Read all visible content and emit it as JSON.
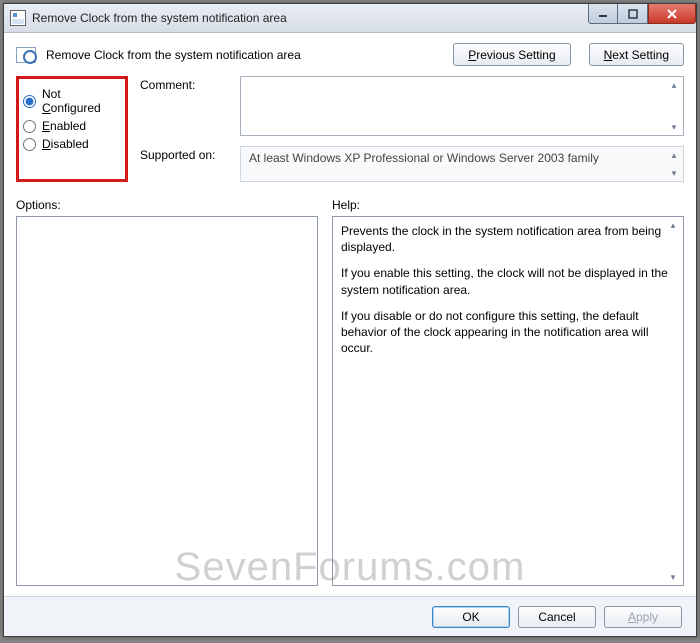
{
  "window": {
    "title": "Remove Clock from the system notification area"
  },
  "header": {
    "text": "Remove Clock from the system notification area",
    "prev_p": "P",
    "prev_rest": "revious Setting",
    "next_n": "N",
    "next_rest": "ext Setting"
  },
  "state": {
    "options": [
      {
        "key": "not_configured",
        "prefix": "Not ",
        "u": "C",
        "suffix": "onfigured",
        "checked": true
      },
      {
        "key": "enabled",
        "prefix": "",
        "u": "E",
        "suffix": "nabled",
        "checked": false
      },
      {
        "key": "disabled",
        "prefix": "",
        "u": "D",
        "suffix": "isabled",
        "checked": false
      }
    ]
  },
  "labels": {
    "comment": "Comment:",
    "supported": "Supported on:",
    "options": "Options:",
    "help": "Help:"
  },
  "comment_value": "",
  "supported_text": "At least Windows XP Professional or Windows Server 2003 family",
  "help_paragraphs": [
    "Prevents the clock in the system notification area from being displayed.",
    "If you enable this setting, the clock will not be displayed in the system notification area.",
    "If you disable or do not configure this setting, the default behavior of the clock appearing in the notification area will occur."
  ],
  "footer": {
    "ok": "OK",
    "cancel": "Cancel",
    "apply_a": "A",
    "apply_rest": "pply"
  },
  "watermark": "SevenForums.com"
}
